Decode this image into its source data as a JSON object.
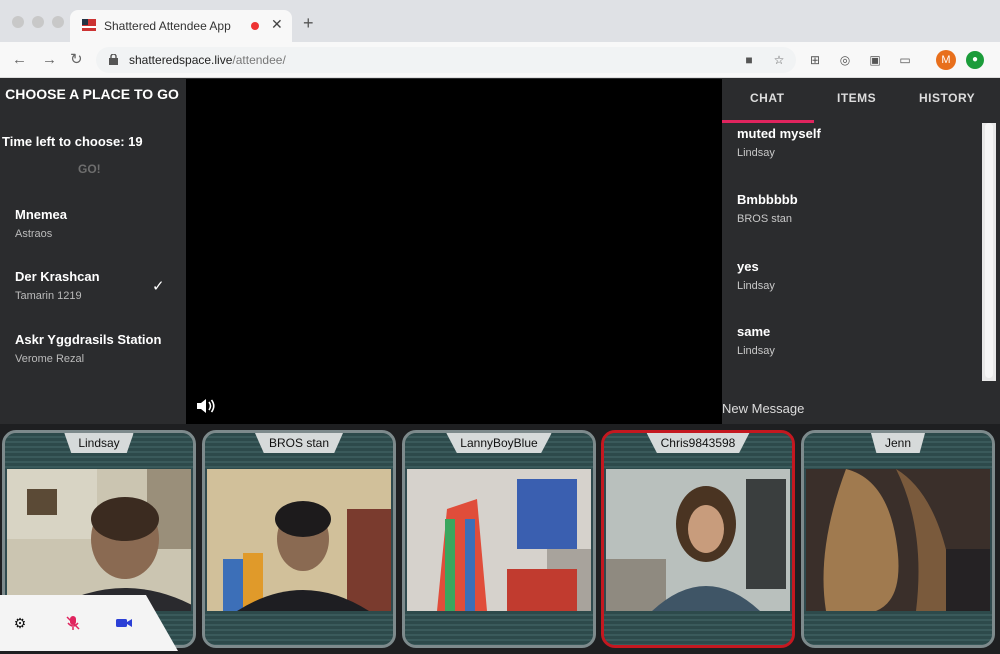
{
  "browser": {
    "tab_title": "Shattered Attendee App",
    "url_host": "shatteredspace.live",
    "url_path": "/attendee/",
    "profile_initial": "M"
  },
  "left_panel": {
    "title": "CHOOSE A PLACE TO GO",
    "time_left": "Time left to choose: 19",
    "go_label": "GO!",
    "places": [
      {
        "name": "Mnemea",
        "owner": "Astraos",
        "selected": false
      },
      {
        "name": "Der Krashcan",
        "owner": "Tamarin 1219",
        "selected": true
      },
      {
        "name": "Askr Yggdrasils Station",
        "owner": "Verome Rezal",
        "selected": false
      }
    ]
  },
  "chat": {
    "tabs": [
      "CHAT",
      "ITEMS",
      "HISTORY"
    ],
    "active_tab": "CHAT",
    "messages": [
      {
        "text": "muted myself",
        "author": "Lindsay"
      },
      {
        "text": "Bmbbbbb",
        "author": "BROS stan"
      },
      {
        "text": "yes",
        "author": "Lindsay"
      },
      {
        "text": "same",
        "author": "Lindsay"
      }
    ],
    "new_message_placeholder": "New Message"
  },
  "participants": [
    {
      "name": "Lindsay",
      "active": false
    },
    {
      "name": "BROS stan",
      "active": false
    },
    {
      "name": "LannyBoyBlue",
      "active": false
    },
    {
      "name": "Chris9843598",
      "active": true
    },
    {
      "name": "Jenn",
      "active": false
    }
  ],
  "colors": {
    "accent": "#e0245e",
    "active_border": "#c41820",
    "tile_band": "#2f4a4e"
  },
  "icons": {
    "settings": "gear-icon",
    "mic": "microphone-muted-icon",
    "camera": "camera-icon",
    "speaker": "speaker-icon"
  }
}
